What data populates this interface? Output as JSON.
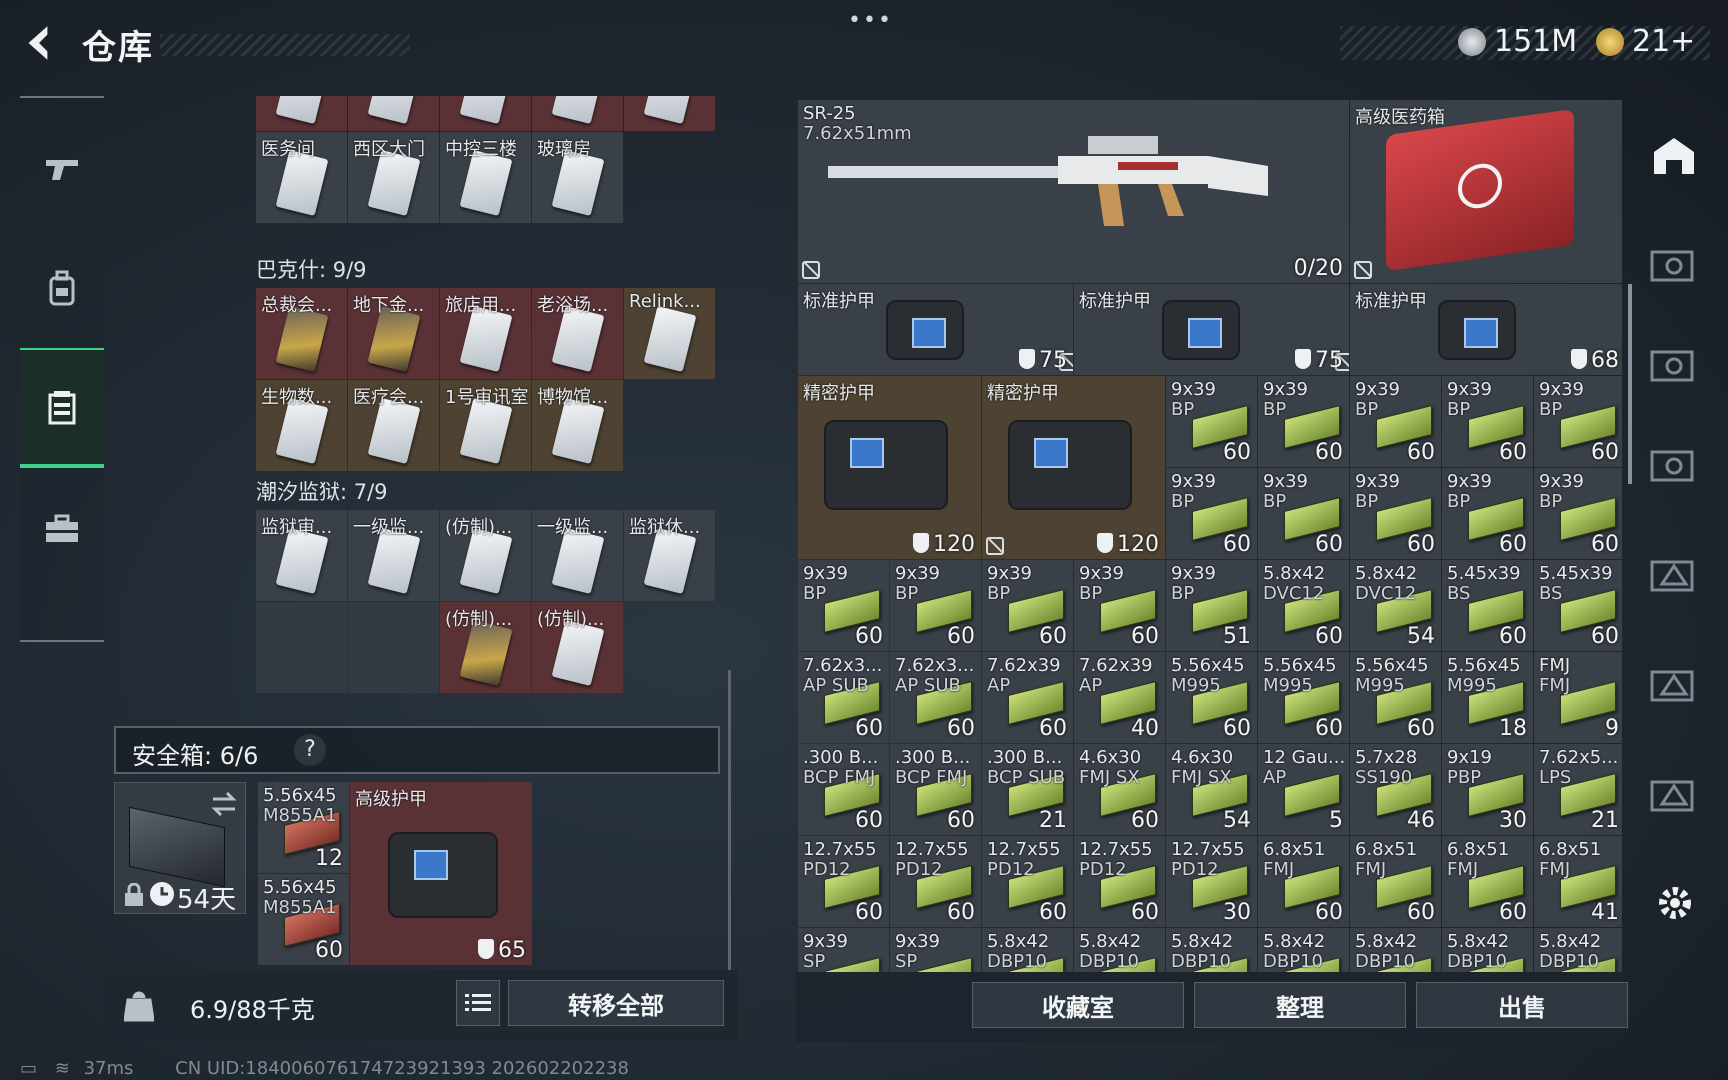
{
  "header": {
    "title": "仓库",
    "currency1": "151M",
    "currency2": "21+",
    "menu": "•••"
  },
  "left_nav": {
    "items": [
      "weapons",
      "backpack",
      "storage",
      "toolbox"
    ],
    "active": "storage"
  },
  "sections": [
    {
      "title": "",
      "items": [
        {
          "label": "",
          "c": "red"
        },
        {
          "label": "",
          "c": "red"
        },
        {
          "label": "",
          "c": "red"
        },
        {
          "label": "",
          "c": "red"
        },
        {
          "label": "",
          "c": "red"
        },
        {
          "label": "医务间"
        },
        {
          "label": "西区大门"
        },
        {
          "label": "中控三楼"
        },
        {
          "label": "玻璃房"
        }
      ]
    },
    {
      "title": "巴克什: 9/9",
      "items": [
        {
          "label": "总裁会...",
          "c": "red",
          "gold": true
        },
        {
          "label": "地下金...",
          "c": "red",
          "gold": true
        },
        {
          "label": "旅店用...",
          "c": "red"
        },
        {
          "label": "老浴场...",
          "c": "red"
        },
        {
          "label": "Relink...",
          "c": "gold"
        },
        {
          "label": "生物数...",
          "c": "gold"
        },
        {
          "label": "医疗会...",
          "c": "gold"
        },
        {
          "label": "1号审讯室",
          "c": "gold"
        },
        {
          "label": "博物馆...",
          "c": "gold"
        }
      ]
    },
    {
      "title": "潮汐监狱: 7/9",
      "items": [
        {
          "label": "监狱审..."
        },
        {
          "label": "一级监..."
        },
        {
          "label": "(仿制)..."
        },
        {
          "label": "一级监..."
        },
        {
          "label": "监狱休..."
        },
        {
          "label": "",
          "c": "empty"
        },
        {
          "label": "",
          "c": "empty"
        },
        {
          "label": "(仿制)...",
          "c": "red",
          "gold": true
        },
        {
          "label": "(仿制)...",
          "c": "red"
        }
      ]
    }
  ],
  "safe": {
    "label": "安全箱: 6/6",
    "help": "?",
    "days": "54天",
    "items": [
      {
        "name": "5.56x45",
        "sub": "M855A1",
        "count": "12"
      },
      {
        "name": "5.56x45",
        "sub": "M855A1",
        "count": "60"
      }
    ],
    "armor": {
      "name": "高级护甲",
      "value": "65"
    }
  },
  "bottom_left": {
    "weight": "6.9/88千克",
    "transfer": "转移全部"
  },
  "status": {
    "ping": "37ms",
    "uid": "CN UID:1840060761747239213​93  202602202238"
  },
  "storage": {
    "weapon": {
      "name": "SR-25",
      "caliber": "7.62x51mm",
      "count": "0/20"
    },
    "medkit": {
      "name": "高级医药箱"
    },
    "armors": [
      {
        "name": "标准护甲",
        "value": "75"
      },
      {
        "name": "标准护甲",
        "value": "75"
      },
      {
        "name": "标准护甲",
        "value": "68"
      }
    ],
    "precision": [
      {
        "name": "精密护甲",
        "value": "120"
      },
      {
        "name": "精密护甲",
        "value": "120"
      }
    ],
    "ammo_top": [
      {
        "a": "9x39",
        "b": "BP",
        "n": "60"
      },
      {
        "a": "9x39",
        "b": "BP",
        "n": "60"
      },
      {
        "a": "9x39",
        "b": "BP",
        "n": "60"
      },
      {
        "a": "9x39",
        "b": "BP",
        "n": "60"
      },
      {
        "a": "9x39",
        "b": "BP",
        "n": "60"
      },
      {
        "a": "9x39",
        "b": "BP",
        "n": "60"
      },
      {
        "a": "9x39",
        "b": "BP",
        "n": "60"
      },
      {
        "a": "9x39",
        "b": "BP",
        "n": "60"
      },
      {
        "a": "9x39",
        "b": "BP",
        "n": "60"
      },
      {
        "a": "9x39",
        "b": "BP",
        "n": "60"
      }
    ],
    "ammo_rows": [
      [
        {
          "a": "9x39",
          "b": "BP",
          "n": "60"
        },
        {
          "a": "9x39",
          "b": "BP",
          "n": "60"
        },
        {
          "a": "9x39",
          "b": "BP",
          "n": "60"
        },
        {
          "a": "9x39",
          "b": "BP",
          "n": "60"
        },
        {
          "a": "9x39",
          "b": "BP",
          "n": "51"
        },
        {
          "a": "5.8x42",
          "b": "DVC12",
          "n": "60"
        },
        {
          "a": "5.8x42",
          "b": "DVC12",
          "n": "54"
        },
        {
          "a": "5.45x39",
          "b": "BS",
          "n": "60"
        },
        {
          "a": "5.45x39",
          "b": "BS",
          "n": "60"
        }
      ],
      [
        {
          "a": "7.62x3...",
          "b": "AP SUB",
          "n": "60"
        },
        {
          "a": "7.62x3...",
          "b": "AP SUB",
          "n": "60"
        },
        {
          "a": "7.62x39",
          "b": "AP",
          "n": "60"
        },
        {
          "a": "7.62x39",
          "b": "AP",
          "n": "40"
        },
        {
          "a": "5.56x45",
          "b": "M995",
          "n": "60"
        },
        {
          "a": "5.56x45",
          "b": "M995",
          "n": "60"
        },
        {
          "a": "5.56x45",
          "b": "M995",
          "n": "60"
        },
        {
          "a": "5.56x45",
          "b": "M995",
          "n": "18"
        },
        {
          "a": "FMJ",
          "b": "FMJ",
          "n": "9"
        }
      ],
      [
        {
          "a": ".300 B...",
          "b": "BCP FMJ",
          "n": "60"
        },
        {
          "a": ".300 B...",
          "b": "BCP FMJ",
          "n": "60"
        },
        {
          "a": ".300 B...",
          "b": "BCP SUB",
          "n": "21"
        },
        {
          "a": "4.6x30",
          "b": "FMJ SX",
          "n": "60"
        },
        {
          "a": "4.6x30",
          "b": "FMJ SX",
          "n": "54"
        },
        {
          "a": "12 Gau...",
          "b": "AP",
          "n": "5"
        },
        {
          "a": "5.7x28",
          "b": "SS190",
          "n": "46"
        },
        {
          "a": "9x19",
          "b": "PBP",
          "n": "30"
        },
        {
          "a": "7.62x5...",
          "b": "LPS",
          "n": "21"
        }
      ],
      [
        {
          "a": "12.7x55",
          "b": "PD12",
          "n": "60"
        },
        {
          "a": "12.7x55",
          "b": "PD12",
          "n": "60"
        },
        {
          "a": "12.7x55",
          "b": "PD12",
          "n": "60"
        },
        {
          "a": "12.7x55",
          "b": "PD12",
          "n": "60"
        },
        {
          "a": "12.7x55",
          "b": "PD12",
          "n": "30"
        },
        {
          "a": "6.8x51",
          "b": "FMJ",
          "n": "60"
        },
        {
          "a": "6.8x51",
          "b": "FMJ",
          "n": "60"
        },
        {
          "a": "6.8x51",
          "b": "FMJ",
          "n": "60"
        },
        {
          "a": "6.8x51",
          "b": "FMJ",
          "n": "41"
        }
      ],
      [
        {
          "a": "9x39",
          "b": "SP",
          "n": ""
        },
        {
          "a": "9x39",
          "b": "SP",
          "n": ""
        },
        {
          "a": "5.8x42",
          "b": "DBP10",
          "n": ""
        },
        {
          "a": "5.8x42",
          "b": "DBP10",
          "n": ""
        },
        {
          "a": "5.8x42",
          "b": "DBP10",
          "n": ""
        },
        {
          "a": "5.8x42",
          "b": "DBP10",
          "n": ""
        },
        {
          "a": "5.8x42",
          "b": "DBP10",
          "n": ""
        },
        {
          "a": "5.8x42",
          "b": "DBP10",
          "n": ""
        },
        {
          "a": "5.8x42",
          "b": "DBP10",
          "n": ""
        }
      ]
    ]
  },
  "bottom_right": {
    "collection": "收藏室",
    "sort": "整理",
    "sell": "出售"
  },
  "colors": {
    "accent": "#3fd08e",
    "red_cell": "#5a3236",
    "gold_cell": "#4e4232",
    "ammo_green": "#9fc24a"
  }
}
